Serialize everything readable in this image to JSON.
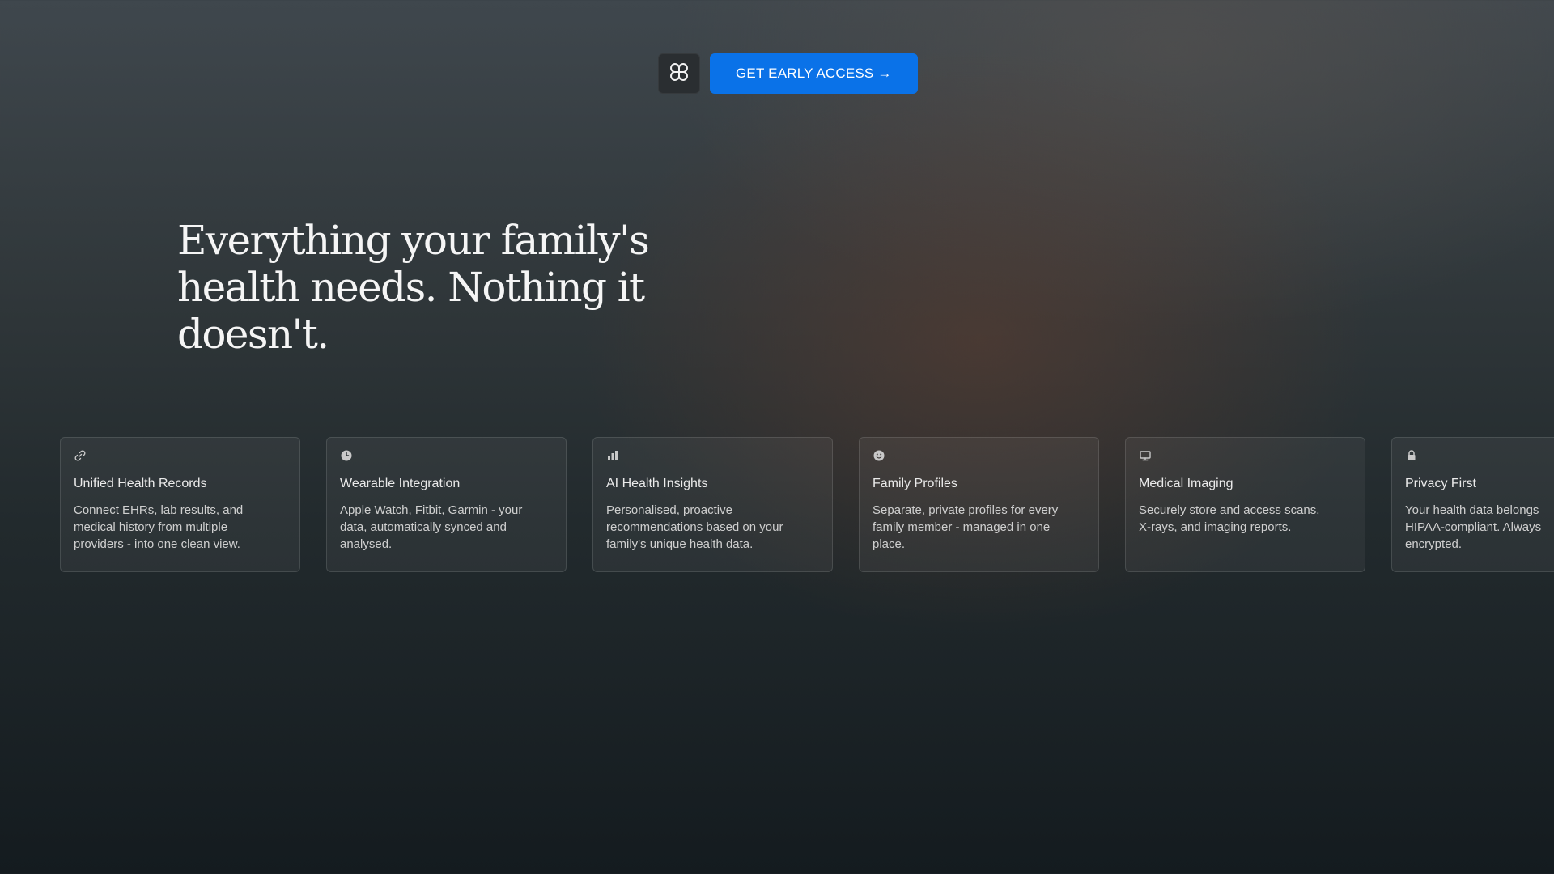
{
  "header": {
    "logo_icon": "four-leaf-logo-icon",
    "cta_label": "GET EARLY ACCESS →",
    "cta_color": "#0a72e8"
  },
  "hero": {
    "line1": "Everything your family's",
    "line2": "health needs. Nothing it doesn't."
  },
  "features": [
    {
      "icon": "link-icon",
      "title": "Unified Health Records",
      "description": "Connect EHRs, lab results, and\nmedical history from multiple\nproviders - into one clean view."
    },
    {
      "icon": "clock-icon",
      "title": "Wearable Integration",
      "description": "Apple Watch, Fitbit, Garmin - your\ndata, automatically synced and\nanalysed."
    },
    {
      "icon": "bar-chart-icon",
      "title": "AI Health Insights",
      "description": " Personalised, proactive\nrecommendations based on your\nfamily's unique health data."
    },
    {
      "icon": "smiley-icon",
      "title": "Family Profiles",
      "description": "Separate, private profiles for every\nfamily member - managed in one\nplace."
    },
    {
      "icon": "monitor-icon",
      "title": "Medical Imaging",
      "description": "Securely store and access scans,\nX-rays, and imaging reports."
    },
    {
      "icon": "lock-icon",
      "title": "Privacy First",
      "description": "Your health data belongs\nHIPAA-compliant. Always\nencrypted."
    }
  ]
}
